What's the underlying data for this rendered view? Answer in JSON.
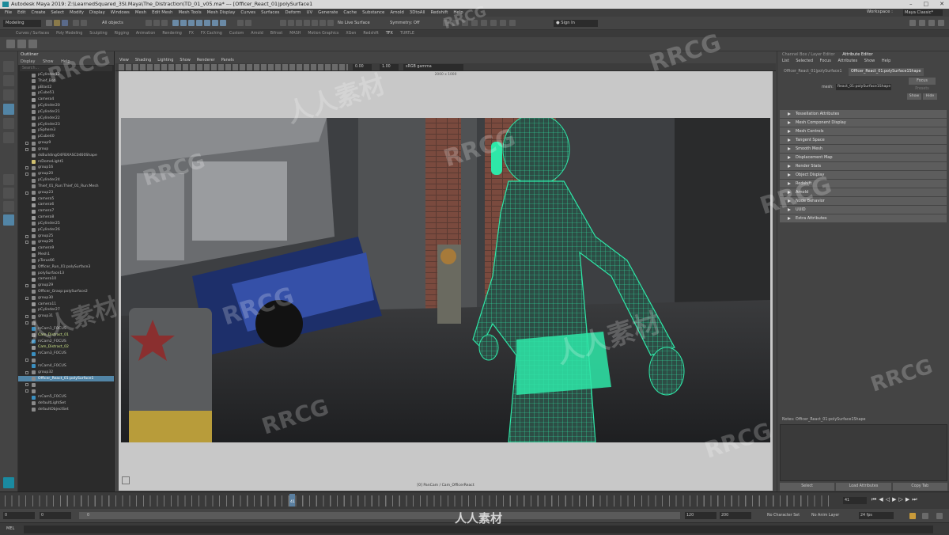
{
  "window": {
    "title": "Autodesk Maya 2019: Z:\\LearnedSquared_3SI.Maya\\The_Distraction\\TD_01_v05.ma* --- [Officer_React_01|polySurface1"
  },
  "menubar": {
    "items": [
      "File",
      "Edit",
      "Create",
      "Select",
      "Modify",
      "Display",
      "Windows",
      "Mesh",
      "Edit Mesh",
      "Mesh Tools",
      "Mesh Display",
      "Curves",
      "Surfaces",
      "Deform",
      "UV",
      "Generate",
      "Cache",
      "Substance",
      "Arnold",
      "3DtoAll",
      "Redshift",
      "Help"
    ],
    "workspace_label": "Workspace :",
    "workspace_value": "Maya Classic*"
  },
  "statusline": {
    "mode": "Modeling",
    "objects": "All objects",
    "live_surface": "No Live Surface",
    "symmetry": "Symmetry: Off",
    "sign_in": "Sign In"
  },
  "shelf": {
    "tabs": [
      "Curves / Surfaces",
      "Poly Modeling",
      "Sculpting",
      "Rigging",
      "Animation",
      "Rendering",
      "FX",
      "FX Caching",
      "Custom",
      "Arnold",
      "Bifrost",
      "MASH",
      "Motion Graphics",
      "XGen",
      "Redshift",
      "TFX",
      "TURTLE"
    ],
    "active": "TFX"
  },
  "outliner": {
    "title": "Outliner",
    "menu": [
      "Display",
      "Show",
      "Help"
    ],
    "search_placeholder": "Search...",
    "rows": [
      {
        "label": "pCylinder12",
        "kind": "mesh"
      },
      {
        "label": "Thief_Bot",
        "kind": "mesh"
      },
      {
        "label": "pBlast2",
        "kind": "mesh"
      },
      {
        "label": "pCube51",
        "kind": "mesh"
      },
      {
        "label": "camera4",
        "kind": "camera"
      },
      {
        "label": "pCylinder20",
        "kind": "mesh"
      },
      {
        "label": "pCylinder21",
        "kind": "mesh"
      },
      {
        "label": "pCylinder22",
        "kind": "mesh"
      },
      {
        "label": "pCylinder23",
        "kind": "mesh"
      },
      {
        "label": "pSphere3",
        "kind": "mesh"
      },
      {
        "label": "pCube40",
        "kind": "mesh"
      },
      {
        "label": "group9",
        "kind": "group"
      },
      {
        "label": "group",
        "kind": "group"
      },
      {
        "label": "dsBuildingO4FBXASC0460Shape",
        "kind": "mesh"
      },
      {
        "label": "rsDomeLight1",
        "kind": "light"
      },
      {
        "label": "group16",
        "kind": "group"
      },
      {
        "label": "group20",
        "kind": "group"
      },
      {
        "label": "pCylinder24",
        "kind": "mesh"
      },
      {
        "label": "Thief_01_Run:Thief_01_Run:Mesh",
        "kind": "mesh"
      },
      {
        "label": "group23",
        "kind": "group"
      },
      {
        "label": "camera5",
        "kind": "camera"
      },
      {
        "label": "camera6",
        "kind": "camera"
      },
      {
        "label": "camera7",
        "kind": "camera"
      },
      {
        "label": "camera8",
        "kind": "camera"
      },
      {
        "label": "pCylinder25",
        "kind": "mesh"
      },
      {
        "label": "pCylinder26",
        "kind": "mesh"
      },
      {
        "label": "group25",
        "kind": "group"
      },
      {
        "label": "group26",
        "kind": "group"
      },
      {
        "label": "camera9",
        "kind": "camera"
      },
      {
        "label": "Mesh1",
        "kind": "mesh"
      },
      {
        "label": "pTorus66",
        "kind": "mesh"
      },
      {
        "label": "Officer_Run_01:polySurface3",
        "kind": "mesh"
      },
      {
        "label": "polySurface13",
        "kind": "mesh"
      },
      {
        "label": "camera10",
        "kind": "camera"
      },
      {
        "label": "group29",
        "kind": "group"
      },
      {
        "label": "Officer_Grasp:polySurface2",
        "kind": "mesh"
      },
      {
        "label": "group30",
        "kind": "group"
      },
      {
        "label": "camera11",
        "kind": "camera"
      },
      {
        "label": "pCylinder27",
        "kind": "mesh"
      },
      {
        "label": "group31",
        "kind": "group"
      },
      {
        "label": "",
        "kind": "group"
      },
      {
        "label": "rsCam1_FOCUS",
        "kind": "locator"
      },
      {
        "label": "Cam_Distract_01",
        "kind": "cam"
      },
      {
        "label": "rsCam2_FOCUS",
        "kind": "locator"
      },
      {
        "label": "Cam_Distract_02",
        "kind": "cam"
      },
      {
        "label": "rsCam3_FOCUS",
        "kind": "locator"
      },
      {
        "label": "",
        "kind": "group"
      },
      {
        "label": "rsCam4_FOCUS",
        "kind": "locator"
      },
      {
        "label": "group32",
        "kind": "group"
      },
      {
        "label": "Officer_React_01:polySurface1",
        "kind": "selected"
      },
      {
        "label": "",
        "kind": "group"
      },
      {
        "label": "",
        "kind": "group"
      },
      {
        "label": "rsCam5_FOCUS",
        "kind": "locator"
      },
      {
        "label": "defaultLightSet",
        "kind": "set"
      },
      {
        "label": "defaultObjectSet",
        "kind": "set"
      }
    ]
  },
  "viewport": {
    "menu": [
      "View",
      "Shading",
      "Lighting",
      "Show",
      "Renderer",
      "Panels"
    ],
    "exposure": "0.00",
    "gamma": "1.00",
    "color_space": "sRGB gamma",
    "resolution": "2000 x 1000",
    "camera_label": "[0] PanCam / Cam_OfficerReact"
  },
  "attribute_editor": {
    "tab_channel": "Channel Box / Layer Editor",
    "tab_attr": "Attribute Editor",
    "menu": [
      "List",
      "Selected",
      "Focus",
      "Attributes",
      "Show",
      "Help"
    ],
    "node_tab_1": "Officer_React_01|polySurface1",
    "node_tab_2": "Officer_React_01:polySurface1Shape",
    "mesh_label": "mesh:",
    "mesh_value": "React_01:polySurface1Shape",
    "focus_btn": "Focus",
    "presets_btn": "Presets",
    "show_btn": "Show",
    "hide_btn": "Hide",
    "sections": [
      "Tessellation Attributes",
      "Mesh Component Display",
      "Mesh Controls",
      "Tangent Space",
      "Smooth Mesh",
      "Displacement Map",
      "Render Stats",
      "Object Display",
      "Redshift",
      "Arnold",
      "Node Behavior",
      "UUID",
      "Extra Attributes"
    ],
    "notes_label": "Notes: Officer_React_01:polySurface1Shape",
    "select_btn": "Select",
    "load_attrs_btn": "Load Attributes",
    "copy_tab_btn": "Copy Tab"
  },
  "timeline": {
    "current_frame": "41",
    "start": "0",
    "start2": "0",
    "range_start": "0",
    "range_end": "120",
    "end": "200",
    "character_set": "No Character Set",
    "anim_layer": "No Anim Layer",
    "fps": "24 fps"
  },
  "helpline": {
    "mode": "MEL"
  },
  "watermark": {
    "text1": "RRCG",
    "text2": "人人素材"
  },
  "colors": {
    "accent": "#5285a6",
    "wireframe": "#2ee8a8"
  }
}
